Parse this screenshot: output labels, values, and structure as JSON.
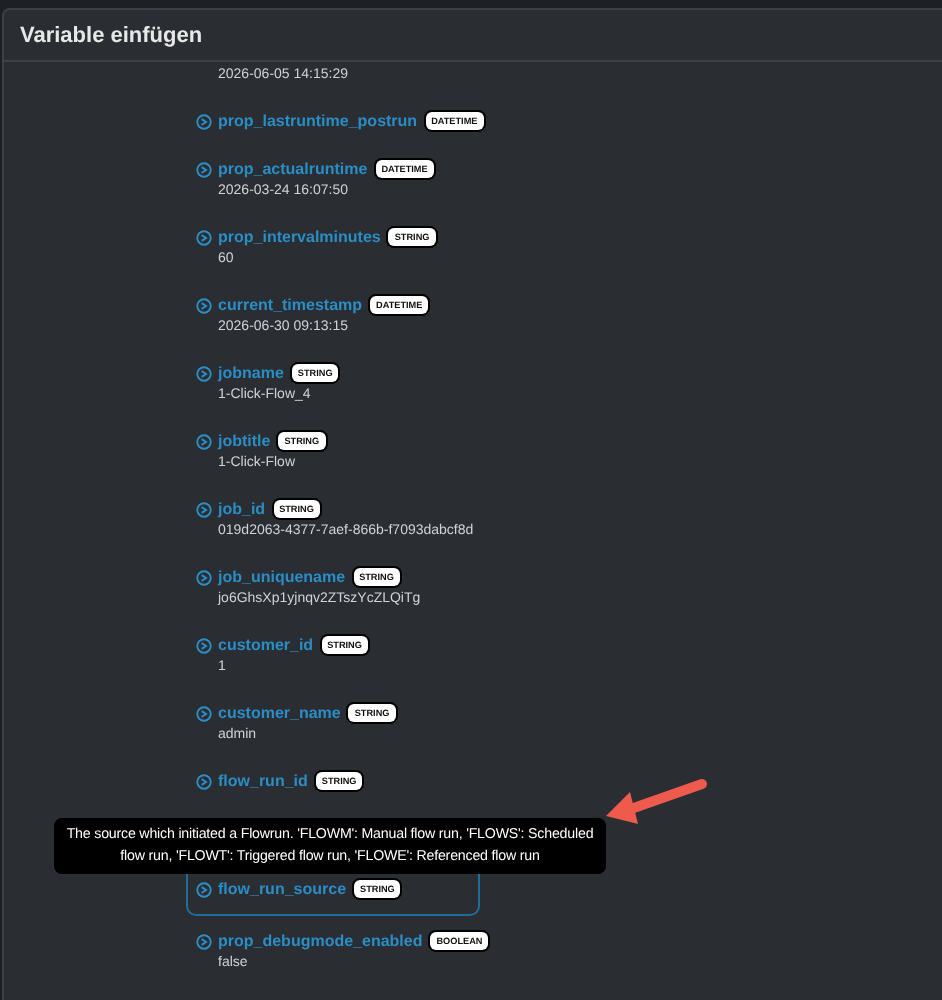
{
  "dialog": {
    "title": "Variable einfügen"
  },
  "variables": [
    {
      "value": "2026-06-05 14:15:29",
      "selected": false
    },
    {
      "name": "prop_lastruntime_postrun",
      "type": "DATETIME",
      "selected": false
    },
    {
      "name": "prop_actualruntime",
      "type": "DATETIME",
      "value": "2026-03-24 16:07:50",
      "selected": false
    },
    {
      "name": "prop_intervalminutes",
      "type": "STRING",
      "value": "60",
      "selected": false
    },
    {
      "name": "current_timestamp",
      "type": "DATETIME",
      "value": "2026-06-30 09:13:15",
      "selected": false
    },
    {
      "name": "jobname",
      "type": "STRING",
      "value": "1-Click-Flow_4",
      "selected": false
    },
    {
      "name": "jobtitle",
      "type": "STRING",
      "value": "1-Click-Flow",
      "selected": false
    },
    {
      "name": "job_id",
      "type": "STRING",
      "value": "019d2063-4377-7aef-866b-f7093dabcf8d",
      "selected": false
    },
    {
      "name": "job_uniquename",
      "type": "STRING",
      "value": "jo6GhsXp1yjnqv2ZTszYcZLQiTg",
      "selected": false
    },
    {
      "name": "customer_id",
      "type": "STRING",
      "value": "1",
      "selected": false
    },
    {
      "name": "customer_name",
      "type": "STRING",
      "value": "admin",
      "selected": false
    },
    {
      "name": "flow_run_id",
      "type": "STRING",
      "selected": false
    },
    {
      "name": "flow_run_source",
      "type": "STRING",
      "selected": true
    },
    {
      "name": "prop_debugmode_enabled",
      "type": "BOOLEAN",
      "value": "false",
      "selected": false
    }
  ],
  "tooltip": {
    "text": "The source which initiated a Flowrun. 'FLOWM': Manual flow run, 'FLOWS': Scheduled flow run, 'FLOWT': Triggered flow run, 'FLOWE': Referenced flow run"
  }
}
